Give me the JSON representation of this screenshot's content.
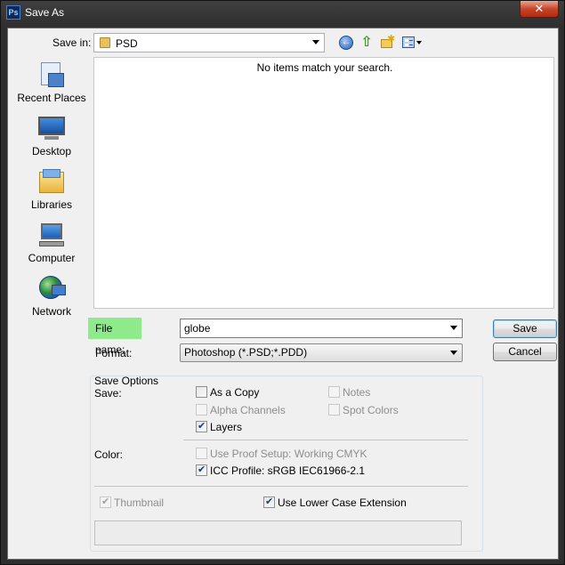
{
  "window": {
    "app_icon": "Ps",
    "title": "Save As",
    "close_glyph": "✕"
  },
  "toolbar": {
    "save_in_label": "Save in:",
    "location": "PSD",
    "icons": [
      "back-icon",
      "up-folder-icon",
      "new-folder-icon",
      "view-menu-icon"
    ]
  },
  "places": [
    {
      "label": "Recent Places",
      "icon": "recent-places-icon"
    },
    {
      "label": "Desktop",
      "icon": "desktop-icon"
    },
    {
      "label": "Libraries",
      "icon": "libraries-icon"
    },
    {
      "label": "Computer",
      "icon": "computer-icon"
    },
    {
      "label": "Network",
      "icon": "network-icon"
    }
  ],
  "file_list": {
    "empty_message": "No items match your search."
  },
  "file_name": {
    "label": "File name:",
    "value": "globe"
  },
  "format": {
    "label": "Format:",
    "value": "Photoshop (*.PSD;*.PDD)"
  },
  "buttons": {
    "save": "Save",
    "cancel": "Cancel"
  },
  "save_options": {
    "title": "Save Options",
    "save_label": "Save:",
    "as_a_copy": {
      "label": "As a Copy",
      "checked": false,
      "enabled": true
    },
    "notes": {
      "label": "Notes",
      "checked": false,
      "enabled": false
    },
    "alpha_channels": {
      "label": "Alpha Channels",
      "checked": false,
      "enabled": false
    },
    "spot_colors": {
      "label": "Spot Colors",
      "checked": false,
      "enabled": false
    },
    "layers": {
      "label": "Layers",
      "checked": true,
      "enabled": true
    },
    "color_label": "Color:",
    "use_proof_setup": {
      "label": "Use Proof Setup:  Working CMYK",
      "checked": false,
      "enabled": false
    },
    "icc_profile": {
      "label": "ICC Profile:  sRGB IEC61966-2.1",
      "checked": true,
      "enabled": true
    },
    "thumbnail": {
      "label": "Thumbnail",
      "checked": true,
      "enabled": false
    },
    "lower_case_ext": {
      "label": "Use Lower Case Extension",
      "checked": true,
      "enabled": true
    }
  },
  "colors": {
    "file_name_highlight": "#8eea8a",
    "title_bar": "#3a3a3a",
    "close_button": "#c7452a"
  }
}
